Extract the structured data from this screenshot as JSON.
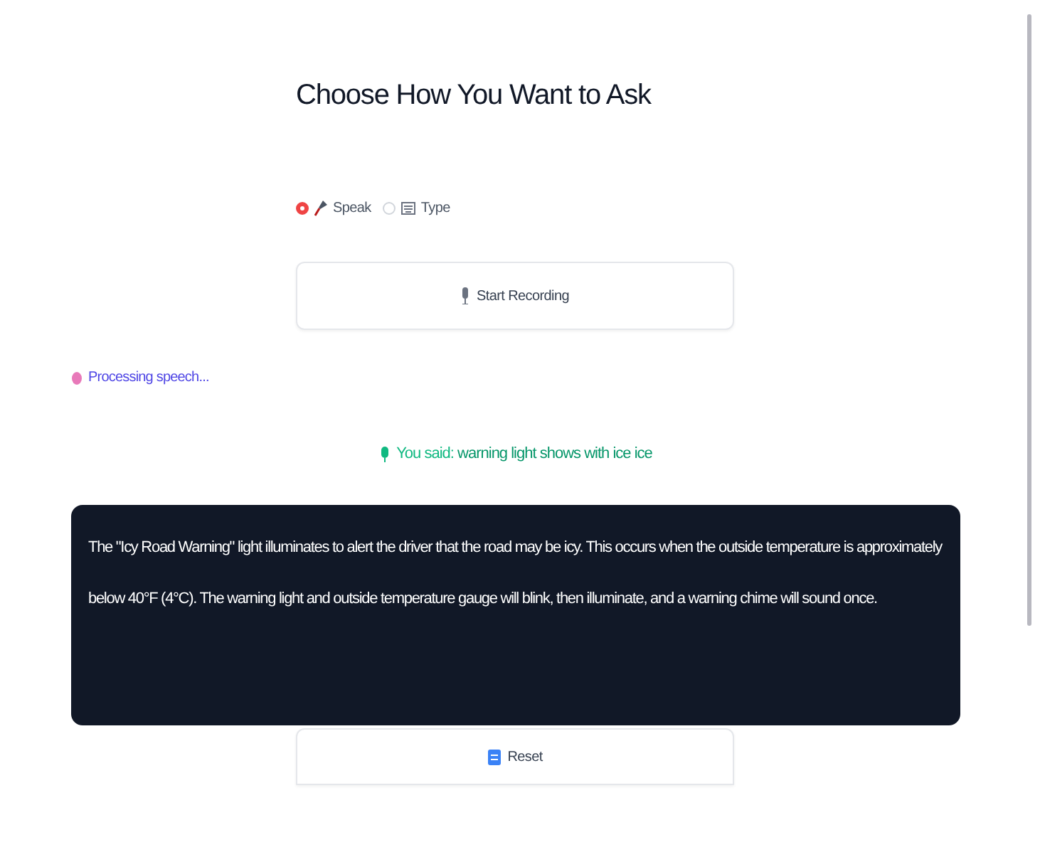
{
  "title": "Choose How You Want to Ask",
  "modes": [
    {
      "label": "Speak",
      "kind": "voice",
      "selected": true
    },
    {
      "label": "Type",
      "kind": "text",
      "selected": false
    }
  ],
  "record_button": "Start Recording",
  "status": "Processing speech...",
  "transcript": {
    "prefix": "You said:",
    "text": "warning light shows with ice ice"
  },
  "answer": "The \"Icy Road Warning\" light illuminates to alert the driver that the road may be icy. This occurs when the outside temperature is approximately below 40°F (4°C). The warning light and outside temperature gauge will blink, then illuminate, and a warning chime will sound once.",
  "reset_button": "Reset"
}
